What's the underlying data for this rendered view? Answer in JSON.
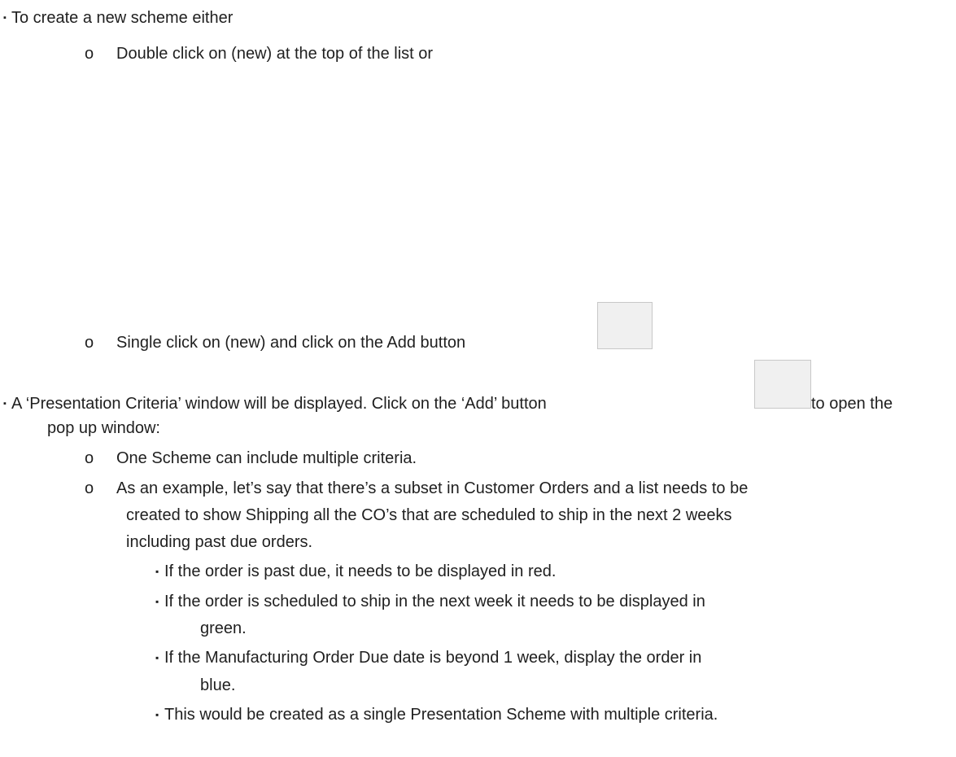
{
  "markers": {
    "level1": "▪",
    "level2": "o",
    "level3": "▪"
  },
  "items": [
    {
      "text": "To create a new scheme either"
    },
    {
      "text": "Double click on (new) at the top of the list or"
    },
    {
      "text": "Single click on (new) and click on the Add button"
    },
    {
      "text": "A ‘Presentation Criteria’ window will be displayed. Click on the ‘Add’ button"
    },
    {
      "text": "to open the"
    },
    {
      "text": "pop up window:"
    },
    {
      "text": "One Scheme can include multiple criteria."
    },
    {
      "text": "As an example, let’s say that there’s a subset in Customer Orders and a list needs to be"
    },
    {
      "text": "created to show Shipping all the CO’s that are scheduled to ship in the next 2 weeks"
    },
    {
      "text": "including past due orders."
    },
    {
      "text": "If the order is past due, it needs to be displayed in red."
    },
    {
      "text": "If the order is scheduled to ship in the next week it needs to be displayed in"
    },
    {
      "text": "green."
    },
    {
      "text": "If the Manufacturing Order Due date is beyond 1 week, display the order in"
    },
    {
      "text": "blue."
    },
    {
      "text": "This would be created as a single Presentation Scheme with multiple criteria."
    }
  ]
}
